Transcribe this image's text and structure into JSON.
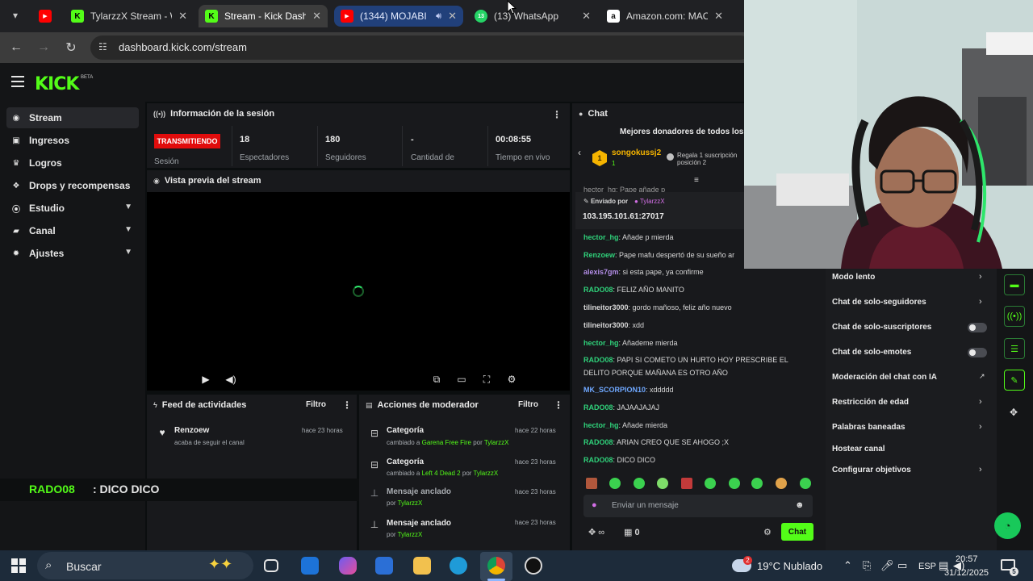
{
  "browser": {
    "tabs": [
      {
        "title": "",
        "favicon": "youtube-icon",
        "color": "#ff0000"
      },
      {
        "title": "TylarzzX Stream - W",
        "favicon": "kick-icon",
        "color": "#53fc18"
      },
      {
        "title": "Stream - Kick Dashb",
        "favicon": "kick-icon",
        "color": "#53fc18",
        "active": true
      },
      {
        "title": "(1344) MOJABI",
        "favicon": "youtube-icon",
        "color": "#ff0000"
      },
      {
        "title": "(13) WhatsApp",
        "favicon": "whatsapp-icon",
        "color": "#25d366",
        "badge": "13"
      },
      {
        "title": "Amazon.com: MAO",
        "favicon": "amazon-icon",
        "color": "#ffffff"
      }
    ],
    "url": "dashboard.kick.com/stream"
  },
  "sidebar": {
    "items": [
      {
        "label": "Stream",
        "icon": "radio-icon"
      },
      {
        "label": "Ingresos",
        "icon": "dollar-icon"
      },
      {
        "label": "Logros",
        "icon": "trophy-icon"
      },
      {
        "label": "Drops y recompensas",
        "icon": "gift-icon"
      },
      {
        "label": "Estudio",
        "icon": "studio-icon"
      },
      {
        "label": "Canal",
        "icon": "channel-icon"
      },
      {
        "label": "Ajustes",
        "icon": "gear-icon"
      }
    ]
  },
  "session": {
    "title": "Información de la sesión",
    "status": "TRANSMITIENDO",
    "status_label": "Sesión",
    "stats": [
      {
        "value": "18",
        "label": "Espectadores"
      },
      {
        "value": "180",
        "label": "Seguidores"
      },
      {
        "value": "-",
        "label": "Cantidad de"
      },
      {
        "value": "00:08:55",
        "label": "Tiempo en vivo"
      }
    ]
  },
  "preview": {
    "title": "Vista previa del stream"
  },
  "feed": {
    "title": "Feed de actividades",
    "filter": "Filtro",
    "items": [
      {
        "name": "Renzoew",
        "sub": "acaba de seguir el canal",
        "time": "hace 23 horas"
      }
    ]
  },
  "mod": {
    "title": "Acciones de moderador",
    "filter": "Filtro",
    "items": [
      {
        "title": "Categoría",
        "prefix": "cambiado a",
        "target": "Garena Free Fire",
        "by": "por",
        "user": "TylarzzX",
        "time": "hace 22 horas"
      },
      {
        "title": "Categoría",
        "prefix": "cambiado a",
        "target": "Left 4 Dead 2",
        "by": "por",
        "user": "TylarzzX",
        "time": "hace 23 horas"
      },
      {
        "title": "Mensaje anclado",
        "prefix": "por",
        "target": "TylarzzX",
        "by": "",
        "user": "",
        "time": "hace 23 horas"
      },
      {
        "title": "Mensaje anclado",
        "prefix": "por",
        "target": "TylarzzX",
        "by": "",
        "user": "",
        "time": "hace 23 horas"
      }
    ]
  },
  "overlay": {
    "user": "RADO08",
    "text": ": DICO DICO"
  },
  "chat": {
    "title": "Chat",
    "donors_title": "Mejores donadores de todos los",
    "donor": {
      "rank": "1",
      "name": "songokussj2",
      "count": "1",
      "note1": "Regala 1 suscripción",
      "note2": "posición 2"
    },
    "pinned": {
      "truncated": "hector_hg: Pape añade p",
      "sent_by": "Enviado por",
      "sender": "TylarzzX",
      "ip": "103.195.101.61:27017"
    },
    "messages": [
      {
        "user": "hector_hg",
        "text": ": Añade p mierda",
        "cls": "u1"
      },
      {
        "user": "Renzoew",
        "text": ": Pape mafu despertó de su sueño ar",
        "cls": "u1"
      },
      {
        "user": "alexis7gm",
        "text": ": si esta pape, ya confirme",
        "cls": "u2"
      },
      {
        "user": "RADO08",
        "text": ": FELIZ AÑO MANITO",
        "cls": "u1"
      },
      {
        "user": "tilineitor3000",
        "text": ": gordo mañoso, feliz año nuevo",
        "cls": "u3"
      },
      {
        "user": "tilineitor3000",
        "text": ": xdd",
        "cls": "u3"
      },
      {
        "user": "hector_hg",
        "text": ": Añademe mierda",
        "cls": "u1"
      },
      {
        "user": "RADO08",
        "text": ": PAPI SI COMETO UN HURTO HOY PRESCRIBE EL",
        "cls": "u1"
      },
      {
        "user": "",
        "text": "DELITO PORQUE MAÑANA ES OTRO AÑO",
        "cls": "u1"
      },
      {
        "user": "MK_SCORPION10",
        "text": ": xddddd",
        "cls": "u4"
      },
      {
        "user": "RADO08",
        "text": ": JAJAAJAJAJ",
        "cls": "u1"
      },
      {
        "user": "hector_hg",
        "text": ": Añade mierda",
        "cls": "u1"
      },
      {
        "user": "RADO08",
        "text": ": ARIAN CREO QUE SE AHOGO ;X",
        "cls": "u1"
      },
      {
        "user": "RADO08",
        "text": ": DICO DICO",
        "cls": "u1"
      }
    ],
    "placeholder": "Enviar un mensaje",
    "kicks": "∞",
    "points": "0",
    "send": "Chat"
  },
  "settings": {
    "items": [
      {
        "label": "Modo lento",
        "control": "chevron"
      },
      {
        "label": "Chat de solo-seguidores",
        "control": "chevron"
      },
      {
        "label": "Chat de solo-suscriptores",
        "control": "toggle"
      },
      {
        "label": "Chat de solo-emotes",
        "control": "toggle"
      },
      {
        "label": "Moderación del chat con IA",
        "control": "external"
      },
      {
        "label": "Restricción de edad",
        "control": "chevron"
      },
      {
        "label": "Palabras baneadas",
        "control": "chevron"
      },
      {
        "label": "Hostear canal",
        "control": "none"
      },
      {
        "label": "Configurar objetivos",
        "control": "chevron"
      }
    ]
  },
  "taskbar": {
    "search": "Buscar",
    "weather": "19°C  Nublado",
    "weather_badge": "2",
    "lang": "ESP",
    "time": "20:57",
    "date": "31/12/2025",
    "notif": "5"
  },
  "colors": {
    "kick_green": "#53fc18",
    "live_red": "#e10c0c",
    "panel": "#18191c"
  }
}
